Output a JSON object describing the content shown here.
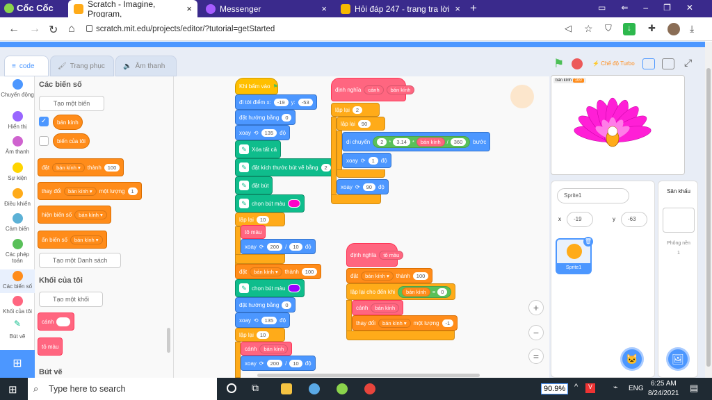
{
  "browser": {
    "brand": "Cốc Cốc",
    "tabs": [
      {
        "title": "Scratch - Imagine, Program,",
        "active": true
      },
      {
        "title": "Messenger",
        "active": false
      },
      {
        "title": "Hỏi đáp 247 - trang tra lời",
        "active": false
      }
    ],
    "new_tab": "+",
    "address": "scratch.mit.edu/projects/editor/?tutorial=getStarted"
  },
  "editor": {
    "tabs": [
      "code",
      "Trang phục",
      "Âm thanh"
    ],
    "categories": [
      {
        "label": "Chuyển động",
        "color": "#4c97ff"
      },
      {
        "label": "Hiển thị",
        "color": "#9966ff"
      },
      {
        "label": "Âm thanh",
        "color": "#cf63cf"
      },
      {
        "label": "Sự kiện",
        "color": "#ffd500"
      },
      {
        "label": "Điều khiển",
        "color": "#ffab19"
      },
      {
        "label": "Cảm biến",
        "color": "#5cb1d6"
      },
      {
        "label": "Các phép toán",
        "color": "#59c059"
      },
      {
        "label": "Các biến số",
        "color": "#ff8c1a"
      },
      {
        "label": "Khối của tôi",
        "color": "#ff6680"
      },
      {
        "label": "Bút vẽ",
        "color": "#0fbd8c"
      }
    ],
    "palette": {
      "vars_heading": "Các biến số",
      "make_var": "Tạo một biến",
      "var1": "bán kính",
      "var2": "biến của tôi",
      "set": "đặt",
      "to": "thành",
      "set_val": "100",
      "change": "thay đổi",
      "by": "một lượng",
      "change_val": "1",
      "show_var": "hiện biến số",
      "hide_var": "ẩn biến số",
      "make_list": "Tạo một Danh sách",
      "myblocks_heading": "Khối của tôi",
      "make_block": "Tạo một khối",
      "canh": "cánh",
      "to_mau": "tô màu",
      "pen_heading": "Bút vẽ"
    },
    "script1": {
      "when_clicked": "Khi bấm vào",
      "goto": "đi tới điểm x:",
      "x": "-19",
      "y_label": "y:",
      "y": "-53",
      "point_dir": "đặt hướng bằng",
      "dir0": "0",
      "turn_left": "xoay",
      "deg135": "135",
      "deg": "độ",
      "clear": "Xóa tất cả",
      "pen_size": "đặt kích thước bút vẽ bằng",
      "pen_size_val": "2",
      "pen_down": "đặt bút",
      "pen_color": "chọn bút màu",
      "repeat": "lặp lại",
      "rep10": "10",
      "to_mau": "tô màu",
      "turn_right": "xoay",
      "div_a": "200",
      "div_b": "10",
      "set": "đặt",
      "var": "bán kính",
      "to": "thành",
      "val100": "100",
      "canh": "cánh"
    },
    "define_canh": {
      "define": "định nghĩa",
      "name": "cánh",
      "param": "bán kính",
      "repeat": "lặp lại",
      "rep2": "2",
      "rep90": "90",
      "move": "di chuyển",
      "two": "2",
      "pi": "3.14",
      "r": "bán kính",
      "d360": "360",
      "steps": "bước",
      "turn": "xoay",
      "one": "1",
      "deg": "độ",
      "ninety": "90"
    },
    "define_tomau": {
      "define": "định nghĩa",
      "name": "tô màu",
      "set": "đặt",
      "var": "bán kính",
      "to": "thành",
      "val": "100",
      "repeat_until": "lặp lại cho đến khi",
      "eq": "=",
      "zero": "0",
      "canh": "cánh",
      "param": "bán kính",
      "change": "thay đổi",
      "by": "một lượng",
      "neg1": "-1"
    },
    "stage": {
      "turbo": "Chế độ Turbo",
      "monitor_label": "bán kính",
      "monitor_value": "100"
    },
    "sprite_info": {
      "name": "Sprite1",
      "x_label": "x",
      "x": "-19",
      "y_label": "y",
      "y": "-63",
      "thumb_label": "Sprite1"
    },
    "stage_panel": {
      "title": "Sân khấu",
      "backdrops": "Phông nền",
      "count": "1"
    }
  },
  "taskbar": {
    "search": "Type here to search",
    "zoom": "90.9%",
    "lang": "ENG",
    "time": "6:25 AM",
    "date": "8/24/2021"
  },
  "colors": {
    "accent": "#4c97ff",
    "tabbar": "#3a2a8c"
  }
}
